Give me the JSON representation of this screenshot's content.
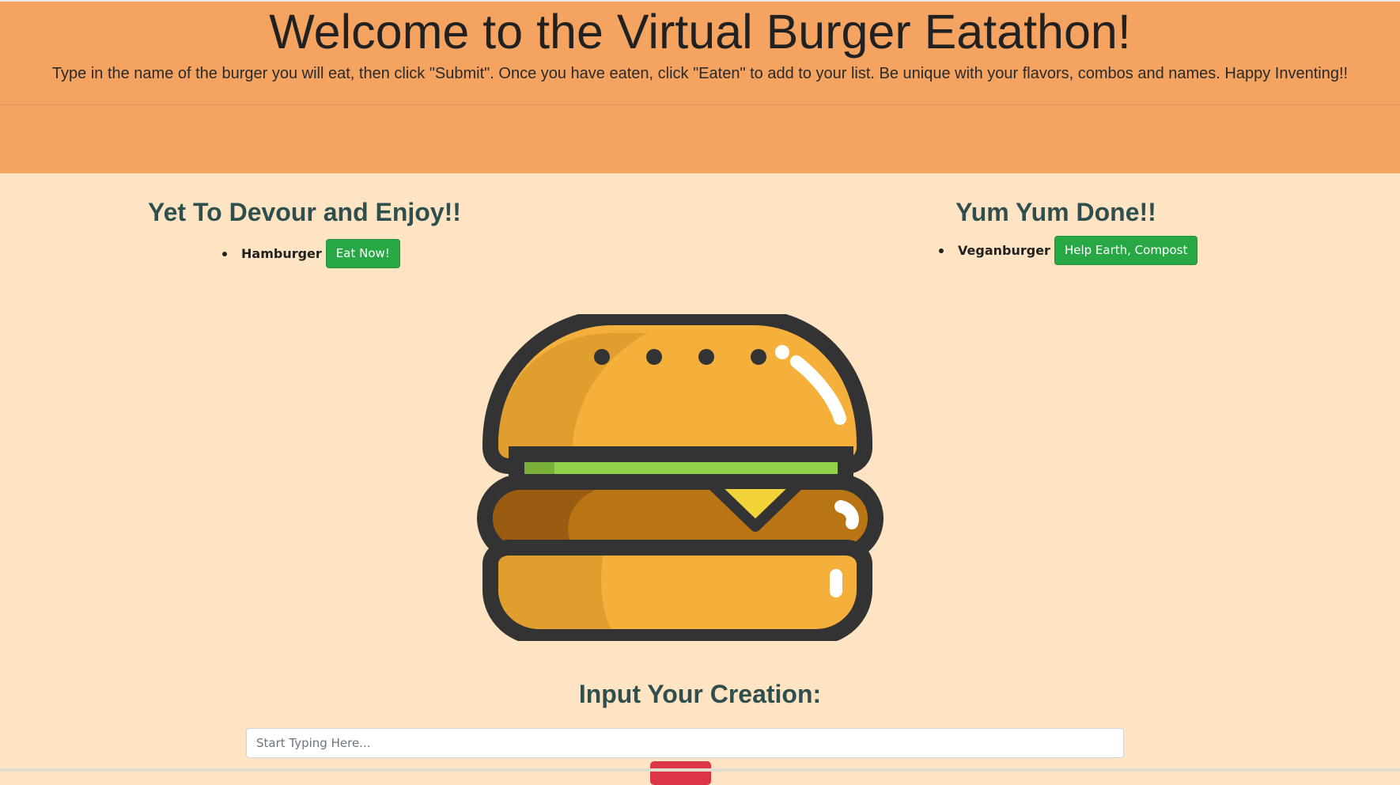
{
  "header": {
    "title": "Welcome to the Virtual Burger Eatathon!",
    "instructions": "Type in the name of the burger you will eat, then click \"Submit\". Once you have eaten, click \"Eaten\" to add to your list. Be unique with your flavors, combos and names. Happy Inventing!!"
  },
  "to_eat": {
    "heading": "Yet To Devour and Enjoy!!",
    "items": [
      {
        "name": "Hamburger",
        "button_label": "Eat Now!"
      }
    ]
  },
  "eaten": {
    "heading": "Yum Yum Done!!",
    "items": [
      {
        "name": "Veganburger",
        "button_label": "Help Earth, Compost"
      }
    ]
  },
  "burger_image": {
    "icon": "burger-illustration"
  },
  "creation": {
    "heading": "Input Your Creation:",
    "input_placeholder": "Start Typing Here...",
    "input_value": ""
  },
  "colors": {
    "page_background": "#ffe4c4",
    "header_background": "#f4a460",
    "heading_color": "#2f4f4f",
    "button_green": "#28a745",
    "button_red": "#dc3545"
  }
}
